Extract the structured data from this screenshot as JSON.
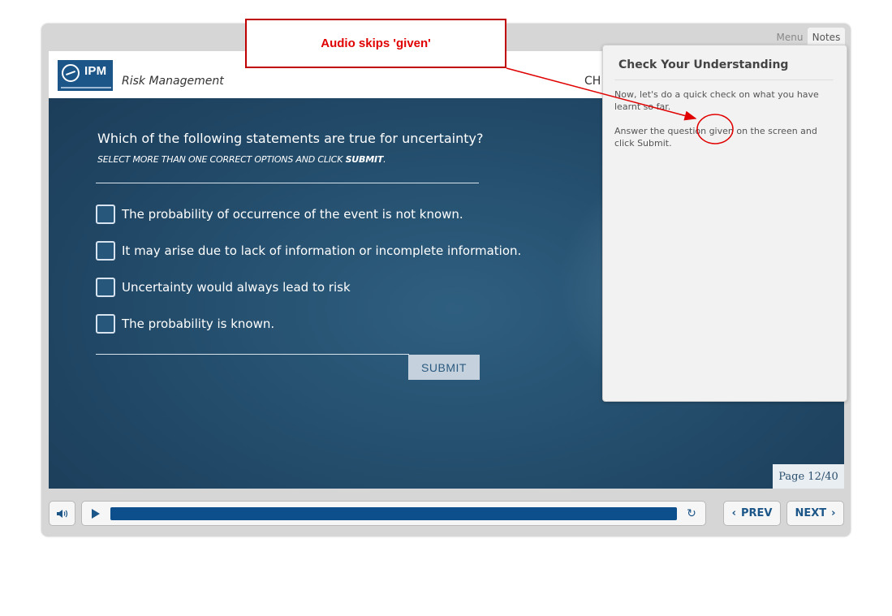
{
  "header": {
    "logo_text": "IPM",
    "course_title": "Risk Management",
    "chapter_title": "CH"
  },
  "tabs": {
    "menu": "Menu",
    "notes": "Notes"
  },
  "quiz": {
    "question": "Which of the following statements are true for uncertainty?",
    "instruction_prefix": "SELECT MORE THAN ONE CORRECT OPTIONS AND CLICK ",
    "instruction_bold": "SUBMIT",
    "instruction_suffix": ".",
    "options": [
      "The probability of occurrence of the event is not known.",
      "It may arise due to lack of information or incomplete information.",
      "Uncertainty would always lead to risk",
      "The probability is known."
    ],
    "submit_label": "SUBMIT"
  },
  "page_indicator": "Page 12/40",
  "notes": {
    "title": "Check Your Understanding",
    "paragraphs": [
      "Now, let's do a quick check on what you have learnt so far.",
      "Answer the question given on the screen and click Submit."
    ]
  },
  "controls": {
    "progress_fraction": 1.0,
    "prev_label": "PREV",
    "next_label": "NEXT"
  },
  "annotation": {
    "text": "Audio skips 'given'",
    "color": "#e00000"
  },
  "colors": {
    "brand": "#1c5588",
    "slide_bg": "#244d6d",
    "progress": "#0c4f8c"
  }
}
